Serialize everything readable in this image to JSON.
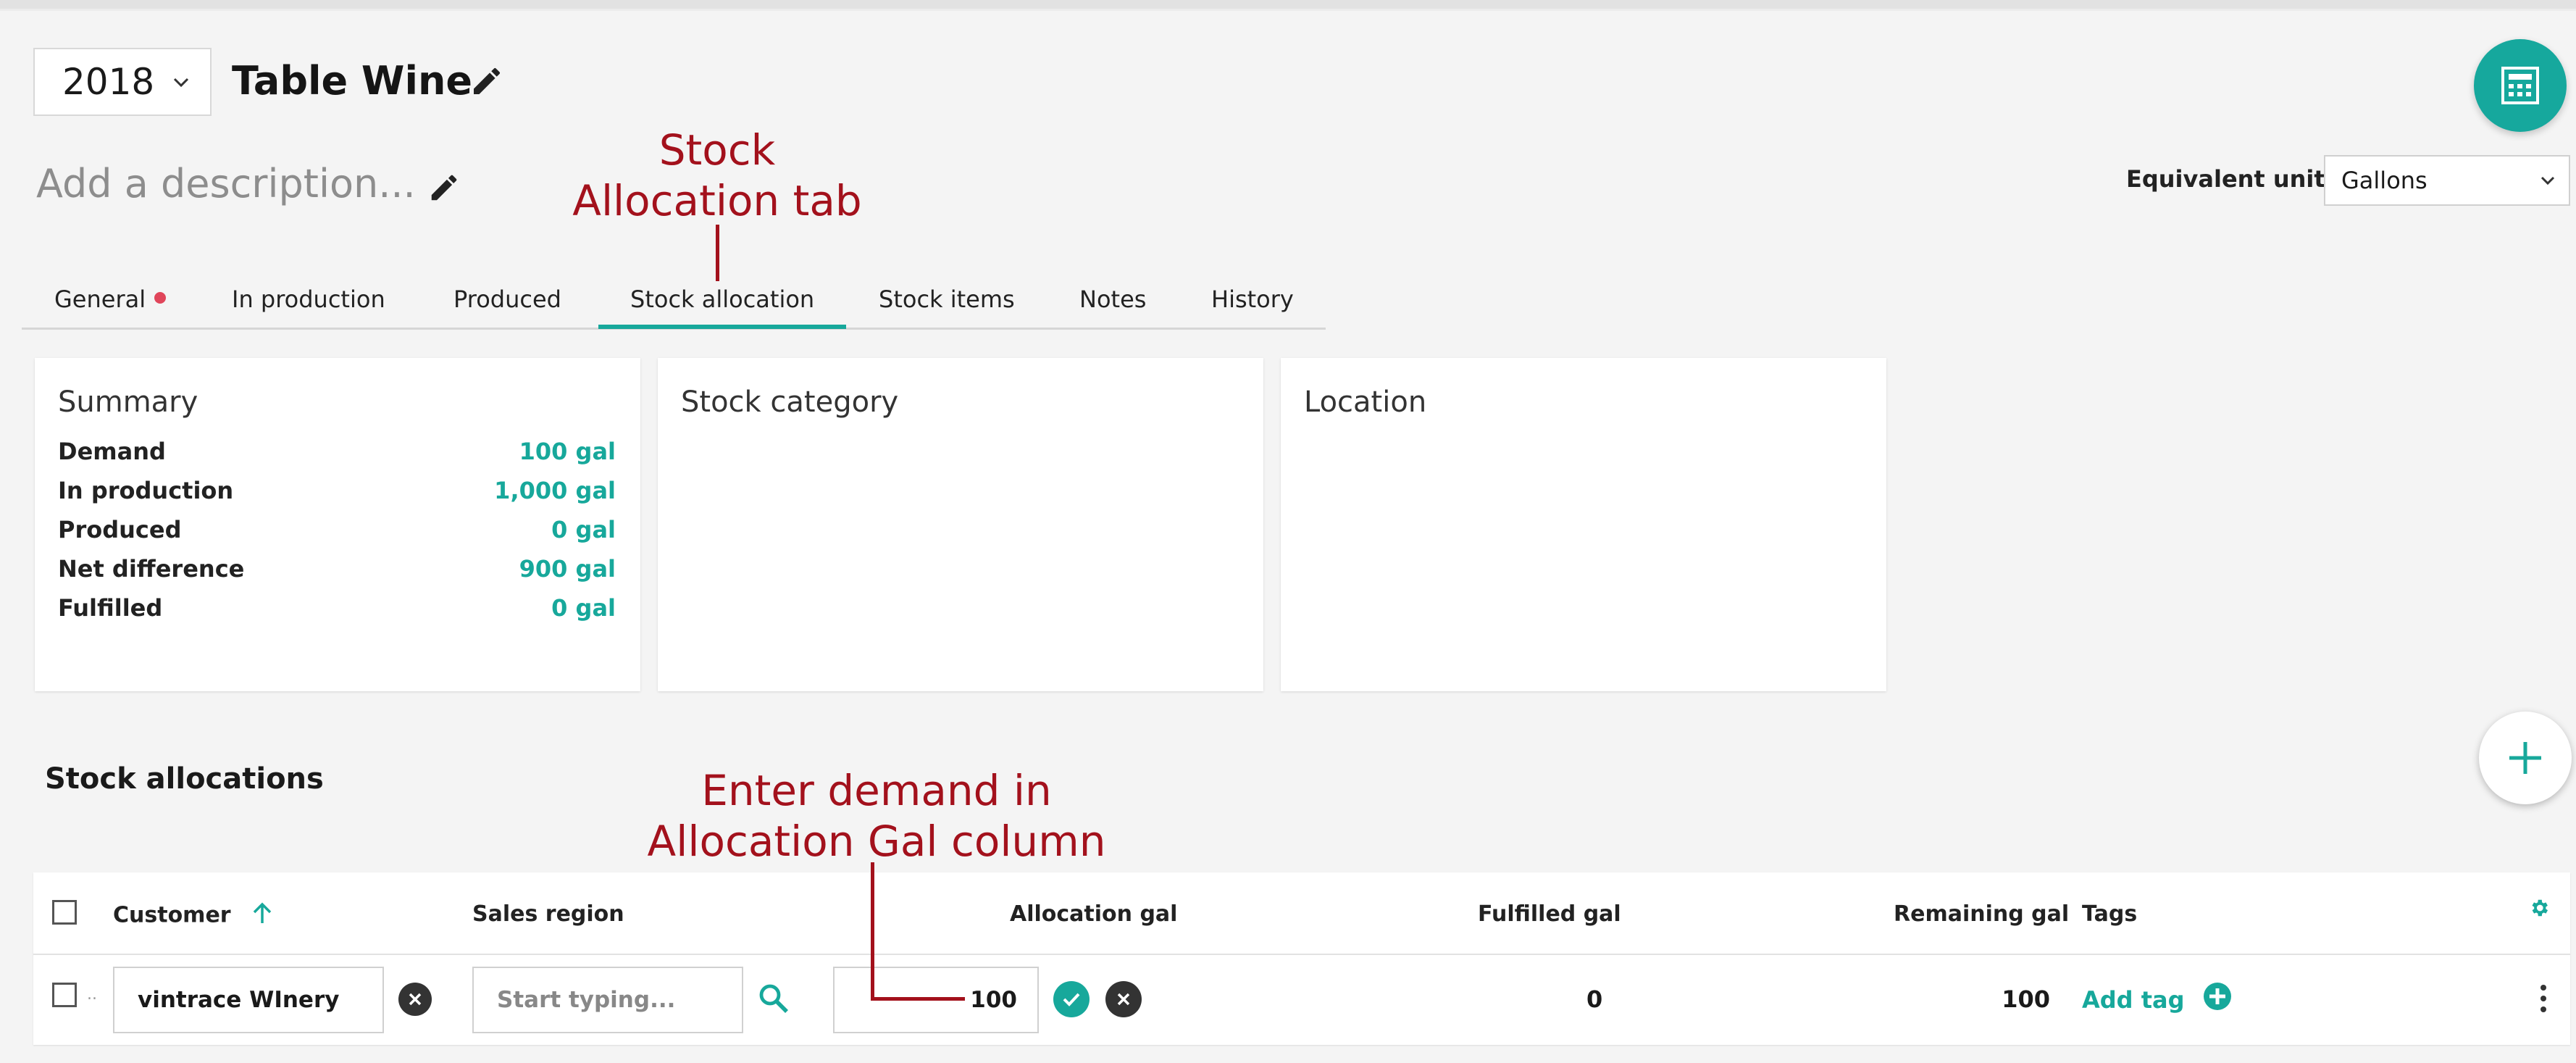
{
  "header": {
    "year": "2018",
    "title": "Table Wine",
    "description_placeholder": "Add a description...",
    "equivalent_unit_label": "Equivalent unit:",
    "equivalent_unit_value": "Gallons"
  },
  "annotations": {
    "tab_note_line1": "Stock",
    "tab_note_line2": "Allocation tab",
    "column_note_line1": "Enter demand in",
    "column_note_line2": "Allocation Gal column",
    "color": "#a3111c"
  },
  "tabs": [
    {
      "label": "General",
      "has_alert": true
    },
    {
      "label": "In production"
    },
    {
      "label": "Produced"
    },
    {
      "label": "Stock allocation",
      "active": true
    },
    {
      "label": "Stock items"
    },
    {
      "label": "Notes"
    },
    {
      "label": "History"
    }
  ],
  "summary": {
    "title": "Summary",
    "rows": [
      {
        "label": "Demand",
        "value": "100 gal"
      },
      {
        "label": "In production",
        "value": "1,000 gal"
      },
      {
        "label": "Produced",
        "value": "0 gal"
      },
      {
        "label": "Net difference",
        "value": "900 gal"
      },
      {
        "label": "Fulfilled",
        "value": "0 gal"
      }
    ]
  },
  "stock_category": {
    "title": "Stock category"
  },
  "location": {
    "title": "Location"
  },
  "stock_allocations": {
    "title": "Stock allocations",
    "columns": {
      "customer": "Customer",
      "sales_region": "Sales region",
      "allocation": "Allocation gal",
      "fulfilled": "Fulfilled gal",
      "remaining": "Remaining gal",
      "tags": "Tags"
    },
    "row": {
      "row_marker": "..",
      "customer": "vintrace WInery",
      "sales_region_placeholder": "Start typing...",
      "allocation": "100",
      "fulfilled": "0",
      "remaining": "100",
      "add_tag": "Add tag"
    }
  },
  "colors": {
    "accent": "#17a89b",
    "alert": "#e0455a"
  }
}
